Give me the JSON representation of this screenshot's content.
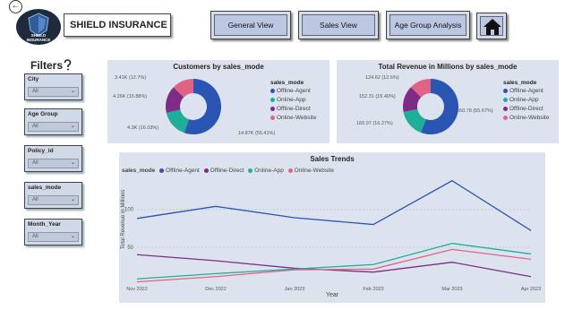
{
  "header": {
    "back_symbol": "←",
    "logo_text_1": "SHIELD",
    "logo_text_2": "INSURANCE",
    "title": "SHIELD INSURANCE"
  },
  "nav": {
    "general_view": "General View",
    "sales_view": "Sales View",
    "age_group_analysis": "Age Group Analysis",
    "home_icon": "home-icon"
  },
  "filters": {
    "title": "Filters",
    "icon": "question-icon",
    "slicers": [
      {
        "label": "City",
        "value": "All"
      },
      {
        "label": "Age Group",
        "value": "All"
      },
      {
        "label": "Policy_id",
        "value": "All"
      },
      {
        "label": "sales_mode",
        "value": "All"
      },
      {
        "label": "Month_Year",
        "value": "All"
      }
    ]
  },
  "colors": {
    "offline_agent": "#2b55b3",
    "online_app": "#1fae97",
    "offline_direct": "#7e2c86",
    "online_website": "#e06386",
    "panel_bg": "#dde3ee"
  },
  "chart_data": [
    {
      "type": "pie",
      "title": "Customers by sales_mode",
      "legend_title": "sales_mode",
      "legend": [
        "Offline-Agent",
        "Online-App",
        "Offline-Direct",
        "Online-Website"
      ],
      "labels": [
        "14.87K (55.41%)",
        "4.3K (16.03%)",
        "4.26K (15.88%)",
        "3.41K (12.7%)"
      ],
      "values": [
        55.41,
        16.03,
        15.88,
        12.7
      ]
    },
    {
      "type": "pie",
      "title": "Total Revenue in Millions by sales_mode",
      "legend_title": "sales_mode",
      "legend": [
        "Offline-Agent",
        "Online-App",
        "Offline-Direct",
        "Online-Website"
      ],
      "labels": [
        "550.78 (55.67%)",
        "160.97 (16.27%)",
        "152.31 (15.40%)",
        "124.62 (12.6%)"
      ],
      "values": [
        55.67,
        16.27,
        15.4,
        12.6
      ]
    },
    {
      "type": "line",
      "title": "Sales Trends",
      "legend_title": "sales_mode",
      "xlabel": "Year",
      "ylabel": "Total Revenue in Millions",
      "categories": [
        "Nov 2022",
        "Dec 2022",
        "Jan 2023",
        "Feb 2023",
        "Mar 2023",
        "Apr 2023"
      ],
      "ylim": [
        0,
        140
      ],
      "yticks": [
        0,
        50,
        100
      ],
      "series": [
        {
          "name": "Offline-Agent",
          "values": [
            88,
            104,
            89,
            80,
            138,
            72
          ]
        },
        {
          "name": "Offline-Direct",
          "values": [
            40,
            32,
            22,
            17,
            30,
            11
          ]
        },
        {
          "name": "Online-App",
          "values": [
            8,
            15,
            21,
            27,
            55,
            41
          ]
        },
        {
          "name": "Online-Website",
          "values": [
            4,
            11,
            20,
            21,
            47,
            34
          ]
        }
      ]
    }
  ]
}
